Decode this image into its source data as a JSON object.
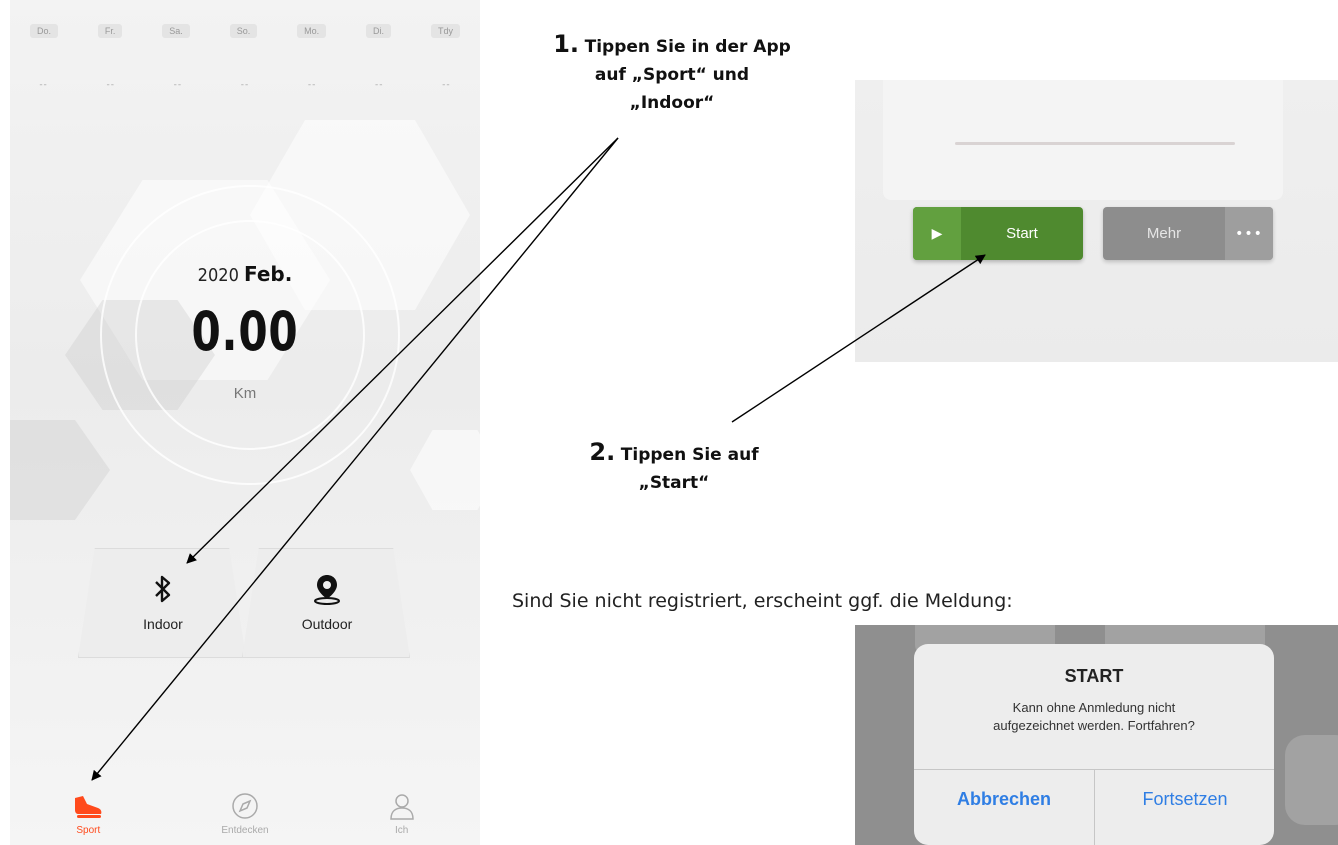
{
  "phone": {
    "weekdays": [
      "Do.",
      "Fr.",
      "Sa.",
      "So.",
      "Mo.",
      "Di.",
      "Tdy"
    ],
    "dash": "--",
    "date": {
      "year": "2020",
      "month": "Feb."
    },
    "distance": "0.00",
    "unit": "Km",
    "modes": [
      {
        "label": "Indoor",
        "icon": "bluetooth-icon"
      },
      {
        "label": "Outdoor",
        "icon": "location-pin-icon"
      }
    ],
    "tabs": [
      {
        "label": "Sport",
        "icon": "shoe-icon",
        "active": true
      },
      {
        "label": "Entdecken",
        "icon": "compass-icon",
        "active": false
      },
      {
        "label": "Ich",
        "icon": "user-icon",
        "active": false
      }
    ],
    "accent_color": "#ff4a1c"
  },
  "step1": {
    "number": "1.",
    "text_line1": "Tippen Sie in der App",
    "text_line2": "auf „Sport“ und",
    "text_line3": "„Indoor“"
  },
  "step2": {
    "number": "2.",
    "text_line1": "Tippen Sie auf",
    "text_line2": "„Start“"
  },
  "start_screen": {
    "start_label": "Start",
    "more_label": "Mehr",
    "start_color": "#4f8a2f",
    "more_color": "#8d8d8d"
  },
  "note": "Sind Sie nicht registriert, erscheint ggf. die Meldung:",
  "dialog": {
    "title": "START",
    "message_line1": "Kann ohne Anmledung nicht",
    "message_line2": "aufgezeichnet werden. Fortfahren?",
    "cancel_label": "Abbrechen",
    "continue_label": "Fortsetzen",
    "link_color": "#2f7ee4"
  }
}
